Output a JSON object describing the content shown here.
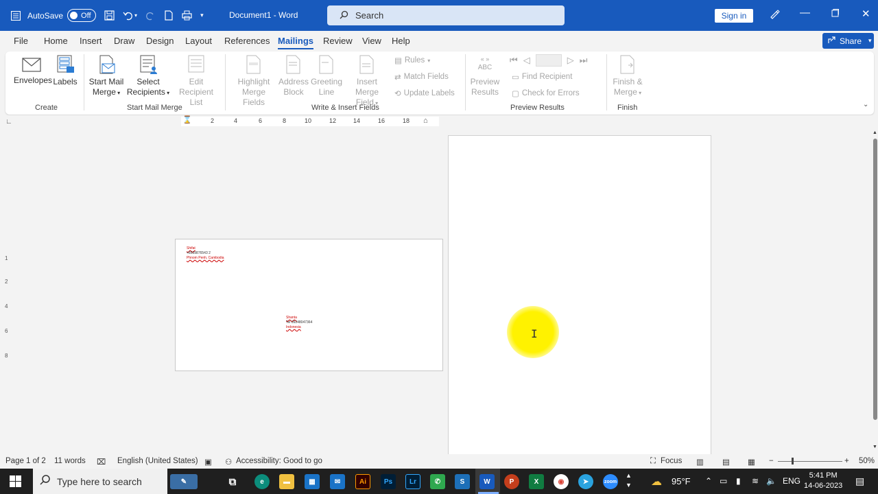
{
  "titlebar": {
    "autosave_label": "AutoSave",
    "autosave_state": "Off",
    "doc_title": "Document1  -  Word",
    "search_placeholder": "Search",
    "signin_label": "Sign in"
  },
  "menu": {
    "tabs": [
      "File",
      "Home",
      "Insert",
      "Draw",
      "Design",
      "Layout",
      "References",
      "Mailings",
      "Review",
      "View",
      "Help"
    ],
    "active": "Mailings",
    "share_label": "Share"
  },
  "ribbon": {
    "envelopes": "Envelopes",
    "labels": "Labels",
    "start_mail_merge_1": "Start Mail",
    "start_mail_merge_2": "Merge",
    "select_recipients_1": "Select",
    "select_recipients_2": "Recipients",
    "edit_recipient_1": "Edit",
    "edit_recipient_2": "Recipient List",
    "highlight_1": "Highlight",
    "highlight_2": "Merge Fields",
    "address_1": "Address",
    "address_2": "Block",
    "greeting_1": "Greeting",
    "greeting_2": "Line",
    "insert_merge_1": "Insert Merge",
    "insert_merge_2": "Field",
    "rules": "Rules",
    "match_fields": "Match Fields",
    "update_labels": "Update Labels",
    "preview_abc": "ABC",
    "preview_1": "Preview",
    "preview_2": "Results",
    "find_recipient": "Find Recipient",
    "check_errors": "Check for Errors",
    "finish_1": "Finish &",
    "finish_2": "Merge",
    "groups": {
      "create": "Create",
      "start_mail_merge": "Start Mail Merge",
      "write_insert": "Write & Insert Fields",
      "preview_results": "Preview Results",
      "finish": "Finish"
    }
  },
  "ruler": {
    "numbers": [
      "2",
      "4",
      "6",
      "8",
      "10",
      "12",
      "14",
      "16",
      "18"
    ],
    "vnumbers": [
      "1",
      "2",
      "4",
      "6",
      "8"
    ]
  },
  "envelope": {
    "return_name": "Shifat",
    "return_phone": "+8559876543 2",
    "return_line3": "Phnom Penh, Cambodia",
    "delivery_name": "Shanta",
    "delivery_tel": "Tel 09248047364",
    "delivery_line3": "Indonesia"
  },
  "statusbar": {
    "page": "Page 1 of 2",
    "words": "11 words",
    "language": "English (United States)",
    "accessibility": "Accessibility: Good to go",
    "focus": "Focus",
    "zoom": "50%"
  },
  "taskbar": {
    "search_placeholder": "Type here to search",
    "weather": "95°F",
    "lang": "ENG",
    "time": "5:41 PM",
    "date": "14-06-2023"
  },
  "colors": {
    "word_blue": "#185abd",
    "highlight_yellow": "#fff200"
  }
}
